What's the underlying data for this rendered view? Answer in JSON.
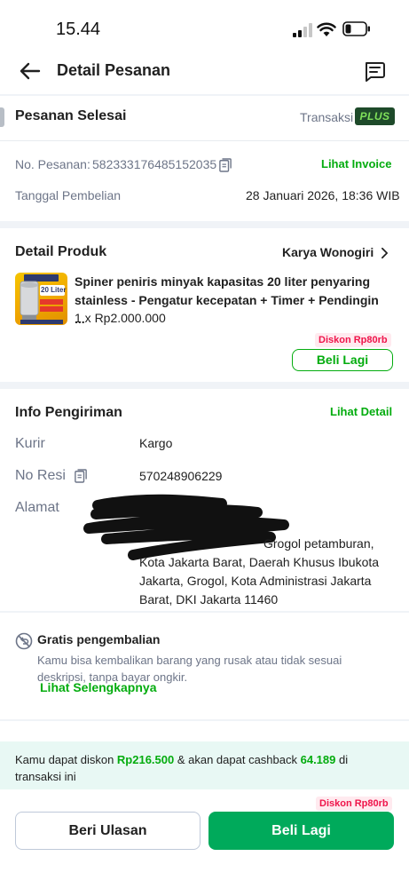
{
  "status_bar": {
    "time": "15.44"
  },
  "app_bar": {
    "title": "Detail Pesanan"
  },
  "order": {
    "status": "Pesanan Selesai",
    "transaction_label": "Transaksi",
    "plus_badge": "PLUS",
    "order_no_label": "No. Pesanan:",
    "order_no": "582333176485152035",
    "invoice_link": "Lihat Invoice",
    "purchase_date_label": "Tanggal Pembelian",
    "purchase_date": "28 Januari 2026, 18:36 WIB"
  },
  "product_section": {
    "title": "Detail Produk",
    "shop_name": "Karya Wonogiri",
    "product_name": "Spiner peniris minyak kapasitas 20 liter penyaring stainless - Pengatur kecepatan + Timer + Pendingin ...",
    "quantity_price": "1 x Rp2.000.000",
    "discount_badge": "Diskon Rp80rb",
    "buy_again": "Beli Lagi",
    "image_badge_text": "20 Liter"
  },
  "shipping": {
    "title": "Info Pengiriman",
    "detail_link": "Lihat Detail",
    "courier_label": "Kurir",
    "courier": "Kargo",
    "resi_label": "No Resi",
    "resi": "570248906229",
    "address_label": "Alamat",
    "address": "Grogol petamburan, Kota Jakarta Barat, Daerah Khusus Ibukota Jakarta, Grogol, Kota Administrasi Jakarta Barat, DKI Jakarta 11460"
  },
  "returns": {
    "title": "Gratis pengembalian",
    "description": "Kamu bisa kembalikan barang yang rusak atau tidak sesuai deskripsi, tanpa bayar ongkir.",
    "link": "Lihat Selengkapnya"
  },
  "cashback": {
    "prefix": "Kamu dapat diskon ",
    "discount": "Rp216.500",
    "middle": " & akan dapat cashback ",
    "cashback": "64.189",
    "suffix": " di transaksi ini"
  },
  "footer": {
    "discount_badge": "Diskon Rp80rb",
    "review_button": "Beri Ulasan",
    "buy_again_button": "Beli Lagi"
  },
  "colors": {
    "primary_green": "#03ac0e",
    "button_green": "#00aa5b",
    "discount_red": "#ef144a",
    "text_grey": "#6d7588"
  }
}
